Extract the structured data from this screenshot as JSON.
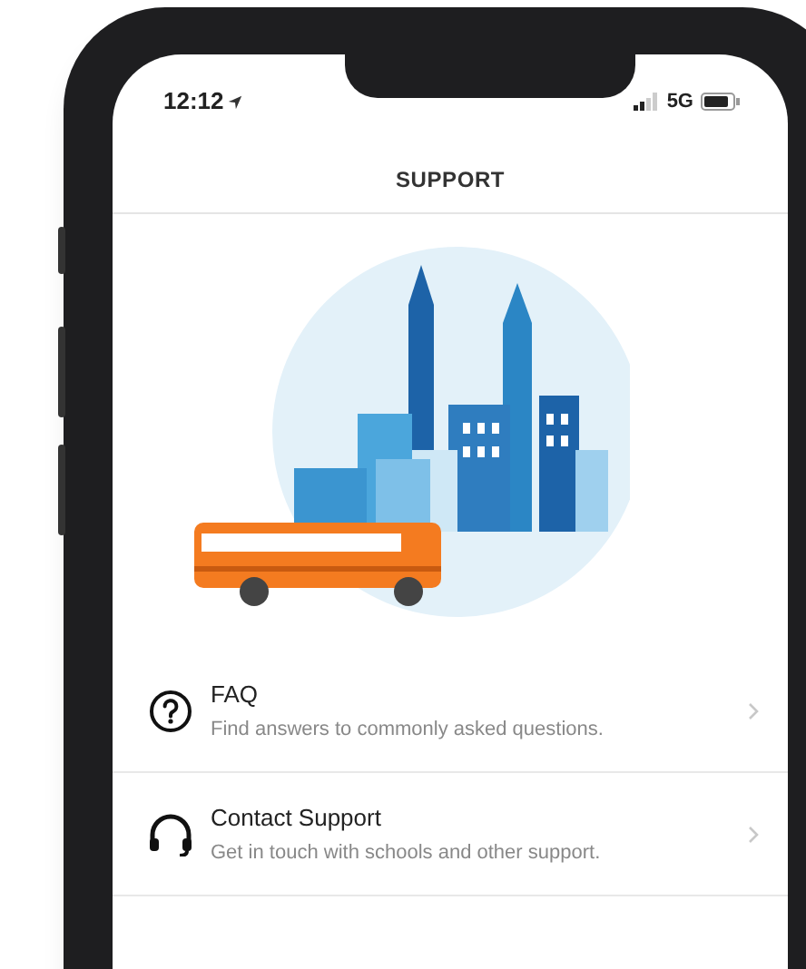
{
  "status_bar": {
    "time": "12:12",
    "network": "5G"
  },
  "header": {
    "title": "SUPPORT"
  },
  "items": [
    {
      "kind": "question",
      "title": "FAQ",
      "subtitle": "Find answers to commonly asked questions."
    },
    {
      "kind": "headphones",
      "title": "Contact Support",
      "subtitle": "Get in touch with schools and other support."
    }
  ]
}
